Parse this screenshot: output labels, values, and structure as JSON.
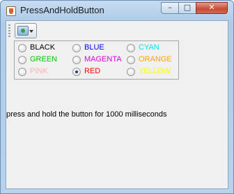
{
  "window": {
    "title": "PressAndHoldButton",
    "controls": {
      "minimize": "–",
      "maximize": "□",
      "close": "✕"
    }
  },
  "toolbar": {
    "button_icon": "image-icon",
    "button_arrow": "chevron-down-icon"
  },
  "colors": [
    {
      "label": "BLACK",
      "color": "#000000",
      "selected": false
    },
    {
      "label": "BLUE",
      "color": "#0000ff",
      "selected": false
    },
    {
      "label": "CYAN",
      "color": "#00e5ee",
      "selected": false
    },
    {
      "label": "GREEN",
      "color": "#00cc00",
      "selected": false
    },
    {
      "label": "MAGENTA",
      "color": "#e000e0",
      "selected": false
    },
    {
      "label": "ORANGE",
      "color": "#ffa500",
      "selected": false
    },
    {
      "label": "PINK",
      "color": "#ffafaf",
      "selected": false
    },
    {
      "label": "RED",
      "color": "#ff0000",
      "selected": true
    },
    {
      "label": "YELLOW",
      "color": "#ffff00",
      "selected": false
    }
  ],
  "status": {
    "text": "press and hold the button for 1000 milliseconds"
  }
}
